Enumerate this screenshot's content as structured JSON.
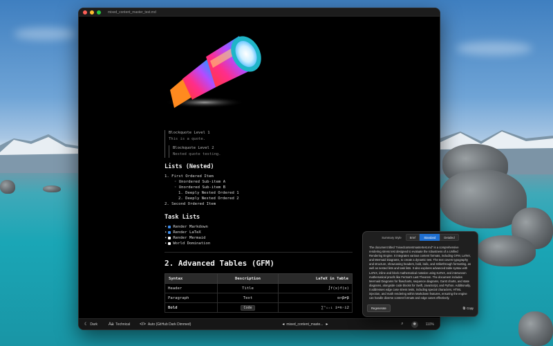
{
  "window": {
    "title": "mixed_content_master_test.md"
  },
  "blockquote": {
    "level1_title": "Blockquote Level 1",
    "level1_text": "This is a quote.",
    "level2_title": "Blockquote Level 2",
    "level2_text": "Nested quote testing."
  },
  "lists": {
    "heading": "Lists (Nested)",
    "items": [
      "1. First Ordered Item",
      "◦ Unordered Sub-item A",
      "◦ Unordered Sub-item B",
      "1. Deeply Nested Ordered 1",
      "2. Deeply Nested Ordered 2",
      "2. Second Ordered Item"
    ]
  },
  "tasks": {
    "heading": "Task Lists",
    "items": [
      {
        "label": "Render Markdown",
        "checked": true
      },
      {
        "label": "Render LaTeX",
        "checked": true
      },
      {
        "label": "Render Mermaid",
        "checked": false
      },
      {
        "label": "World Domination",
        "checked": false
      }
    ]
  },
  "tables": {
    "heading": "2. Advanced Tables (GFM)",
    "columns": [
      "Syntax",
      "Description",
      "LaTeX in Table"
    ],
    "rows": [
      [
        "Header",
        "Title",
        "∫f(x)f(x)"
      ],
      [
        "Paragraph",
        "Text",
        "α+β≠β"
      ],
      [
        "Bold",
        "Code",
        "∑ⁿᵢ₌₁ i=n·i2"
      ]
    ]
  },
  "statusbar": {
    "theme": "Dark",
    "style": "Technical",
    "font": "Auto (GitHub Dark Dimmed)",
    "file": "mixed_content_maste...",
    "zoom": "110%"
  },
  "summary_panel": {
    "label": "Summary Style",
    "options": [
      "Brief",
      "Standard",
      "Detailed"
    ],
    "selected": "Standard",
    "text": "The document titled \"mixedcontentmastertest.md\" is a comprehensive rendering stress test designed to evaluate the robustness of a Unified Rendering Engine. It integrates various content formats, including GFM, LaTeX, and Mermaid Diagrams, to create a dynamic test. The text covers typography and structure, showcasing headers, bold, italic, and strikethrough formatting, as well as nested lists and task lists. It also explores advanced table syntax with LaTeX, inline and block mathematical notation using KaTeX, and interwoven mathematical proofs like Fermat's Last Theorem. The document includes Mermaid Diagrams for flowcharts, sequence diagrams, Gantt charts, and state diagrams, alongside code blocks for Swift, JavaScript, and Python. Additionally, it addresses edge case stress tests, including special characters, HTML injection, and math rendering within Markdown features, ensuring the engine can handle diverse content formats and edge cases effectively.",
    "regenerate_label": "Regenerate",
    "copy_label": "Copy"
  },
  "colors": {
    "accent": "#1f6fd1",
    "task_checked": "#3d8ef0",
    "task_unchecked": "#ffffff"
  }
}
